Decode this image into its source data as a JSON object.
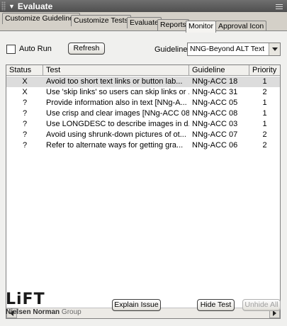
{
  "panel": {
    "title": "Evaluate"
  },
  "tabs": [
    {
      "label": "Customize Guidelines",
      "active": false
    },
    {
      "label": "Customize Tests",
      "active": false
    },
    {
      "label": "Evaluate",
      "active": false
    },
    {
      "label": "Reports",
      "active": false
    },
    {
      "label": "Monitor",
      "active": true
    },
    {
      "label": "Approval Icon",
      "active": false
    }
  ],
  "toolbar": {
    "autorun_label": "Auto Run",
    "autorun_checked": false,
    "refresh_label": "Refresh",
    "guidelines_label": "Guidelines:",
    "guidelines_value": "NNG-Beyond ALT Text"
  },
  "table": {
    "columns": [
      "Status",
      "Test",
      "Guideline",
      "Priority"
    ],
    "rows": [
      {
        "status": "X",
        "test": "Avoid too short text links or button lab...",
        "guideline": "NNg-ACC 18",
        "priority": "1",
        "selected": true
      },
      {
        "status": "X",
        "test": "Use 'skip links' so users can skip links or ...",
        "guideline": "NNg-ACC 31",
        "priority": "2",
        "selected": false
      },
      {
        "status": "?",
        "test": "Provide information also in text [NNg-A...",
        "guideline": "NNg-ACC 05",
        "priority": "1",
        "selected": false
      },
      {
        "status": "?",
        "test": "Use crisp and clear images [NNg-ACC 08]",
        "guideline": "NNg-ACC 08",
        "priority": "1",
        "selected": false
      },
      {
        "status": "?",
        "test": "Use LONGDESC to describe images in d...",
        "guideline": "NNg-ACC 03",
        "priority": "1",
        "selected": false
      },
      {
        "status": "?",
        "test": "Avoid using shrunk-down pictures of ot...",
        "guideline": "NNg-ACC 07",
        "priority": "2",
        "selected": false
      },
      {
        "status": "?",
        "test": "Refer to alternate ways for getting gra...",
        "guideline": "NNg-ACC 06",
        "priority": "2",
        "selected": false
      }
    ]
  },
  "footer": {
    "logo_word": "LiFT",
    "logo_sub_a": "Nielsen Norman",
    "logo_sub_b": "Group",
    "explain_label": "Explain Issue",
    "hide_label": "Hide Test",
    "unhide_label": "Unhide All"
  }
}
